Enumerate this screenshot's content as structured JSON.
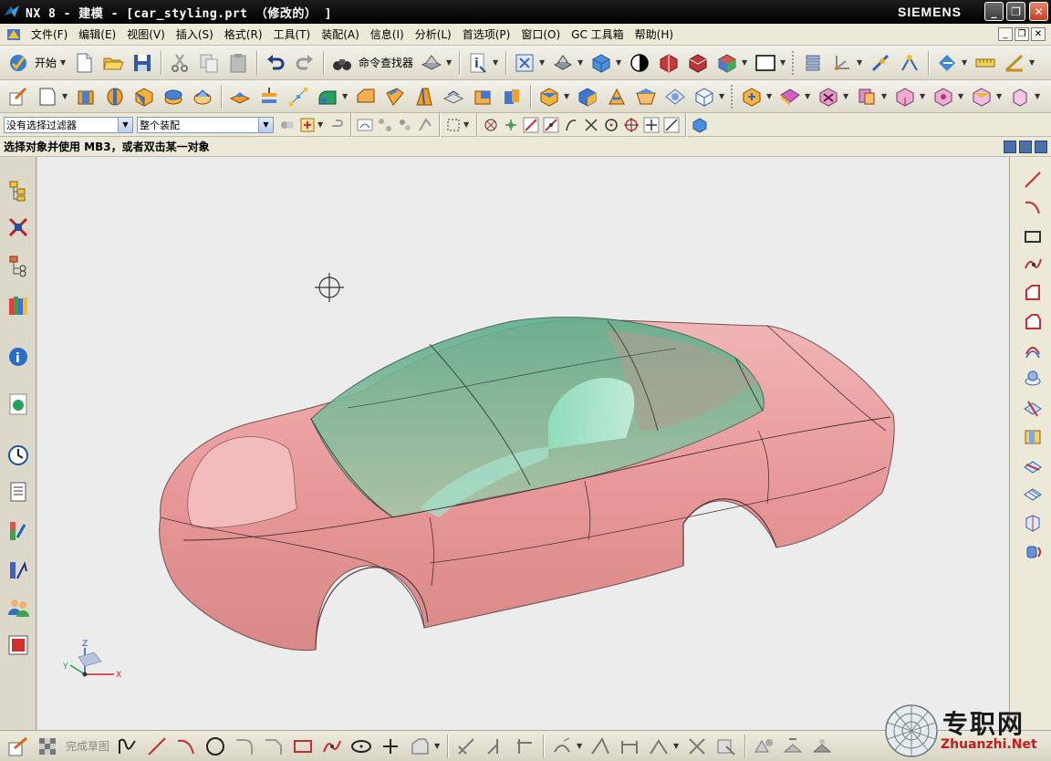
{
  "window": {
    "title": "NX 8 - 建模 - [car_styling.prt （修改的） ]",
    "brand": "SIEMENS",
    "minimize": "_",
    "restore": "❐",
    "close": "✕"
  },
  "menubar": {
    "items": [
      "文件(F)",
      "编辑(E)",
      "视图(V)",
      "插入(S)",
      "格式(R)",
      "工具(T)",
      "装配(A)",
      "信息(I)",
      "分析(L)",
      "首选项(P)",
      "窗口(O)",
      "GC 工具箱",
      "帮助(H)"
    ],
    "doc_buttons": [
      "_",
      "❐",
      "✕"
    ]
  },
  "toolbar1": {
    "start_label": "开始",
    "command_finder_label": "命令查找器",
    "more": "»"
  },
  "selection_bar": {
    "filter_value": "没有选择过滤器",
    "scope_value": "整个装配"
  },
  "prompt": {
    "text": "选择对象并使用 MB3，或者双击某一对象"
  },
  "sketch_bar": {
    "finish_sketch_label": "完成草图"
  },
  "triad": {
    "x_label": "X",
    "y_label": "Y",
    "z_label": "Z"
  },
  "watermark": {
    "cn": "专职网",
    "en": "Zhuanzhi.Net"
  },
  "colors": {
    "body_pink": "#e9a0a0",
    "glass_green": "#7cc2a6",
    "viewport_bg": "#ececec",
    "title_bg": "#000000"
  }
}
